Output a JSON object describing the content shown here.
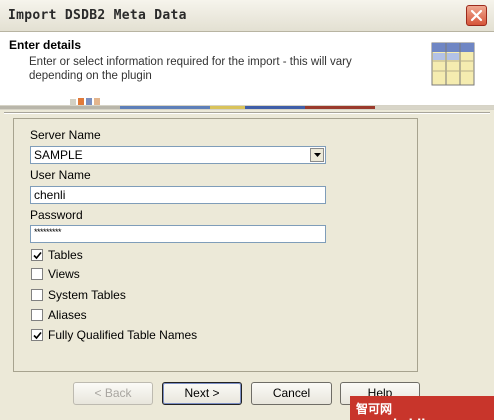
{
  "window": {
    "title": "Import DSDB2 Meta Data"
  },
  "header": {
    "title": "Enter details",
    "description": "Enter or select information required for the import - this will vary depending on the plugin"
  },
  "form": {
    "server_name_label": "Server Name",
    "server_name_value": "SAMPLE",
    "user_name_label": "User Name",
    "user_name_value": "chenli",
    "password_label": "Password",
    "password_mask": "*********",
    "options": [
      {
        "label": "Tables",
        "checked": true
      },
      {
        "label": "Views",
        "checked": false
      },
      {
        "label": "System Tables",
        "checked": false
      },
      {
        "label": "Aliases",
        "checked": false
      },
      {
        "label": "Fully Qualified Table Names",
        "checked": true
      }
    ]
  },
  "buttons": {
    "back": "< Back",
    "next": "Next >",
    "cancel": "Cancel",
    "help": "Help"
  },
  "watermark": {
    "text": "智可网 www.hzhike.com"
  },
  "colors": {
    "dialog_bg": "#ece9d8",
    "header_bg": "#ffffff",
    "watermark_bg": "#c8352b"
  }
}
